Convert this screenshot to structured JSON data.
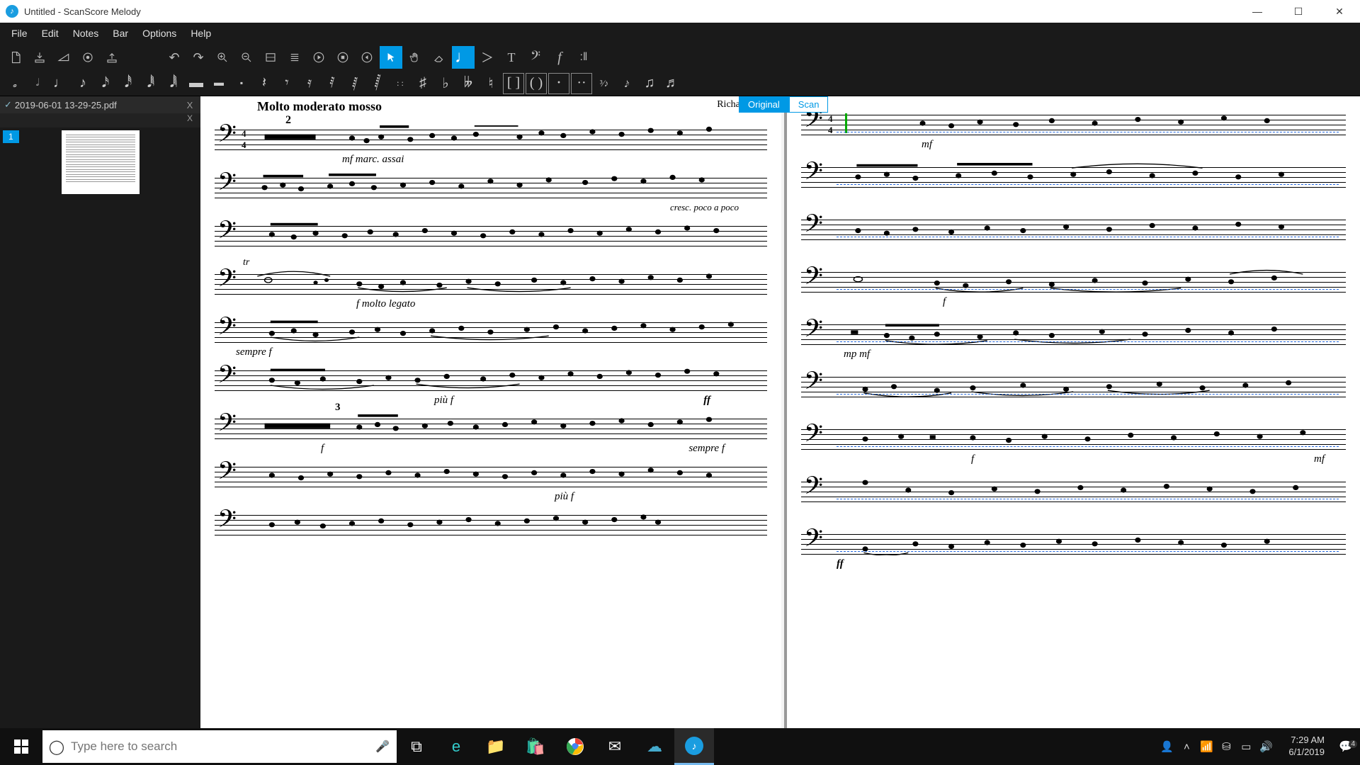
{
  "titlebar": {
    "title": "Untitled - ScanScore Melody"
  },
  "menu": {
    "items": [
      "File",
      "Edit",
      "Notes",
      "Bar",
      "Options",
      "Help"
    ]
  },
  "doc": {
    "filename": "2019-06-01 13-29-25.pdf",
    "page_num": "1"
  },
  "tabs": {
    "original": "Original",
    "scan": "Scan"
  },
  "score": {
    "tempo": "Molto moderato mosso",
    "composer": "Richard W",
    "multirest": "2",
    "triplet": "3",
    "markings": {
      "mf_marc": "mf marc. assai",
      "cresc": "cresc. poco a poco",
      "f_legato": "f molto legato",
      "sempre_f": "sempre f",
      "piu_f": "più f",
      "ff": "ff",
      "sempre_f2": "sempre f",
      "f": "f",
      "piu_f2": "più f",
      "mf": "mf",
      "mp_mf": "mp mf"
    }
  },
  "taskbar": {
    "search_placeholder": "Type here to search",
    "time": "7:29 AM",
    "date": "6/1/2019",
    "notif_count": "4"
  }
}
